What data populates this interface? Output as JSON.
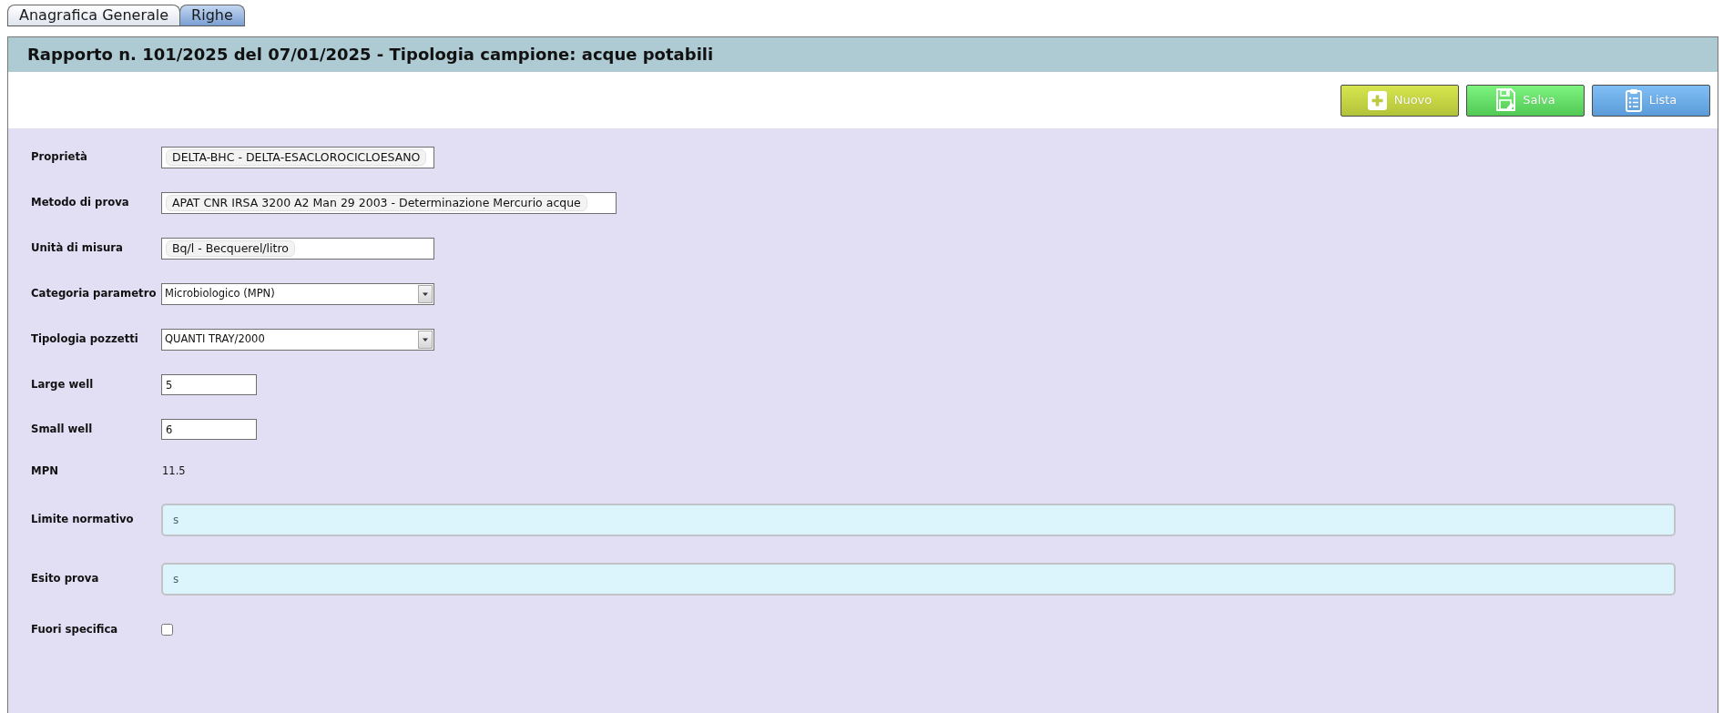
{
  "tabs": [
    {
      "label": "Anagrafica Generale",
      "selected": false
    },
    {
      "label": "Righe",
      "selected": true
    }
  ],
  "header": {
    "title": "Rapporto n. 101/2025 del 07/01/2025 - Tipologia campione: acque potabili"
  },
  "toolbar": {
    "buttons": [
      {
        "kind": "new",
        "label": "Nuovo"
      },
      {
        "kind": "save",
        "label": "Salva"
      },
      {
        "kind": "list",
        "label": "Lista"
      }
    ]
  },
  "form": {
    "fields": [
      {
        "kind": "tag",
        "label": "Proprietà",
        "value": "DELTA-BHC - DELTA-ESACLOROCICLOESANO"
      },
      {
        "kind": "tag",
        "label": "Metodo di prova",
        "value": "APAT CNR IRSA 3200 A2 Man 29 2003 - Determinazione Mercurio acque"
      },
      {
        "kind": "tag",
        "label": "Unità di misura",
        "value": "Bq/l - Becquerel/litro"
      },
      {
        "kind": "select",
        "label": "Categoria parametro",
        "value": "Microbiologico (MPN)"
      },
      {
        "kind": "select",
        "label": "Tipologia pozzetti",
        "value": "QUANTI TRAY/2000"
      },
      {
        "kind": "number",
        "label": "Large well",
        "value": "5"
      },
      {
        "kind": "number",
        "label": "Small well",
        "value": "6"
      },
      {
        "kind": "readout",
        "label": "MPN",
        "value": "11.5"
      },
      {
        "kind": "textarea",
        "label": "Limite normativo",
        "value": "s"
      },
      {
        "kind": "textarea",
        "label": "Esito prova",
        "value": "s"
      },
      {
        "kind": "checkbox",
        "label": "Fuori specifica",
        "checked": false
      }
    ]
  }
}
